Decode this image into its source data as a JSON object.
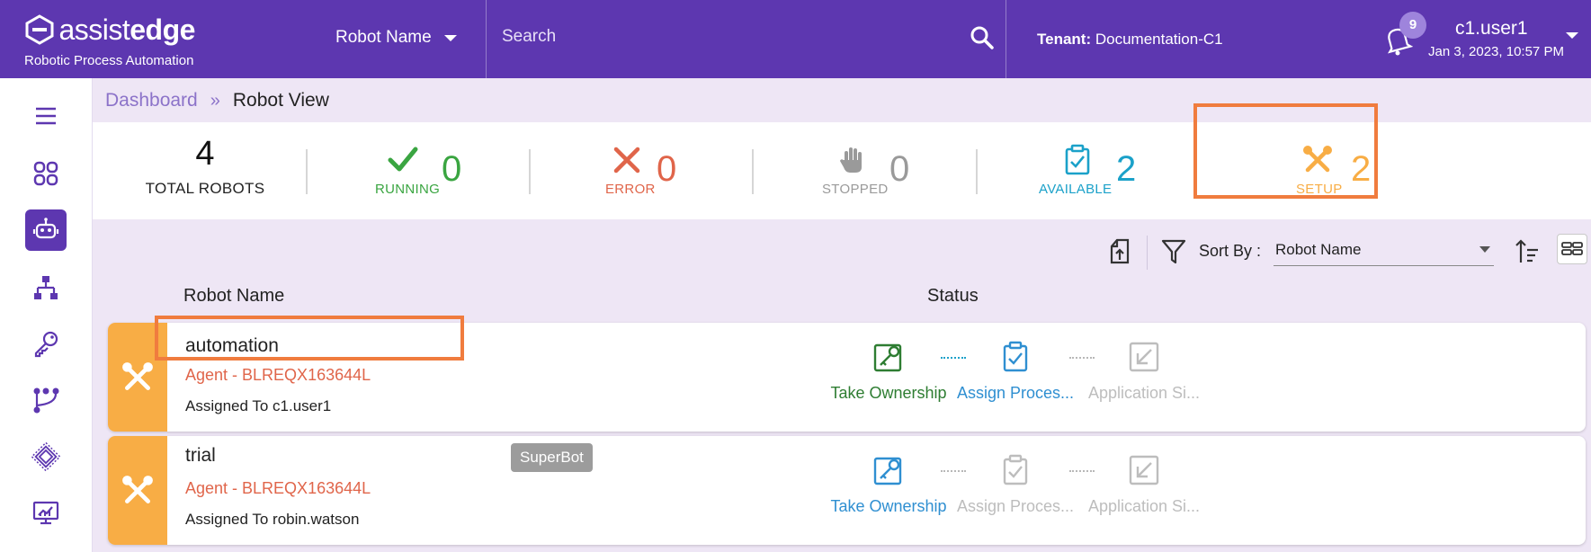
{
  "header": {
    "logo_text_light": "assist",
    "logo_text_bold": "edge",
    "logo_subtitle": "Robotic Process Automation",
    "robot_select_label": "Robot Name",
    "search_placeholder": "Search",
    "tenant_label": "Tenant:",
    "tenant_value": "Documentation-C1",
    "notification_count": "9",
    "user_name": "c1.user1",
    "user_timestamp": "Jan 3, 2023, 10:57 PM"
  },
  "colors": {
    "brand": "#5d37b0",
    "running": "#3aa541",
    "error": "#e0654a",
    "stopped": "#9a9a9a",
    "available": "#1ba1c9",
    "setup": "#f8ad45",
    "highlight": "#f07c3e"
  },
  "sidebar": {
    "items": [
      {
        "icon": "hamburger-menu-icon"
      },
      {
        "icon": "dashboard-grid-icon"
      },
      {
        "icon": "robot-icon",
        "active": true
      },
      {
        "icon": "hierarchy-icon"
      },
      {
        "icon": "key-icon"
      },
      {
        "icon": "workflow-icon"
      },
      {
        "icon": "chip-icon"
      },
      {
        "icon": "monitor-chart-icon"
      }
    ]
  },
  "breadcrumb": {
    "parent": "Dashboard",
    "separator": "»",
    "current": "Robot View"
  },
  "stats": {
    "total_value": "4",
    "total_label": "TOTAL ROBOTS",
    "running_label": "RUNNING",
    "running_value": "0",
    "error_label": "ERROR",
    "error_value": "0",
    "stopped_label": "STOPPED",
    "stopped_value": "0",
    "available_label": "AVAILABLE",
    "available_value": "2",
    "setup_label": "SETUP",
    "setup_value": "2"
  },
  "toolbar": {
    "sort_by_label": "Sort By :",
    "sort_by_value": "Robot Name"
  },
  "columns": {
    "robot_name": "Robot Name",
    "status": "Status"
  },
  "robots": [
    {
      "name": "automation",
      "agent": "Agent - BLREQX163644L",
      "assigned": "Assigned To c1.user1",
      "steps": [
        "Take Ownership",
        "Assign Proces...",
        "Application Si..."
      ]
    },
    {
      "name": "trial",
      "badge": "SuperBot",
      "agent": "Agent - BLREQX163644L",
      "assigned": "Assigned To robin.watson",
      "steps": [
        "Take Ownership",
        "Assign Proces...",
        "Application Si..."
      ]
    }
  ]
}
